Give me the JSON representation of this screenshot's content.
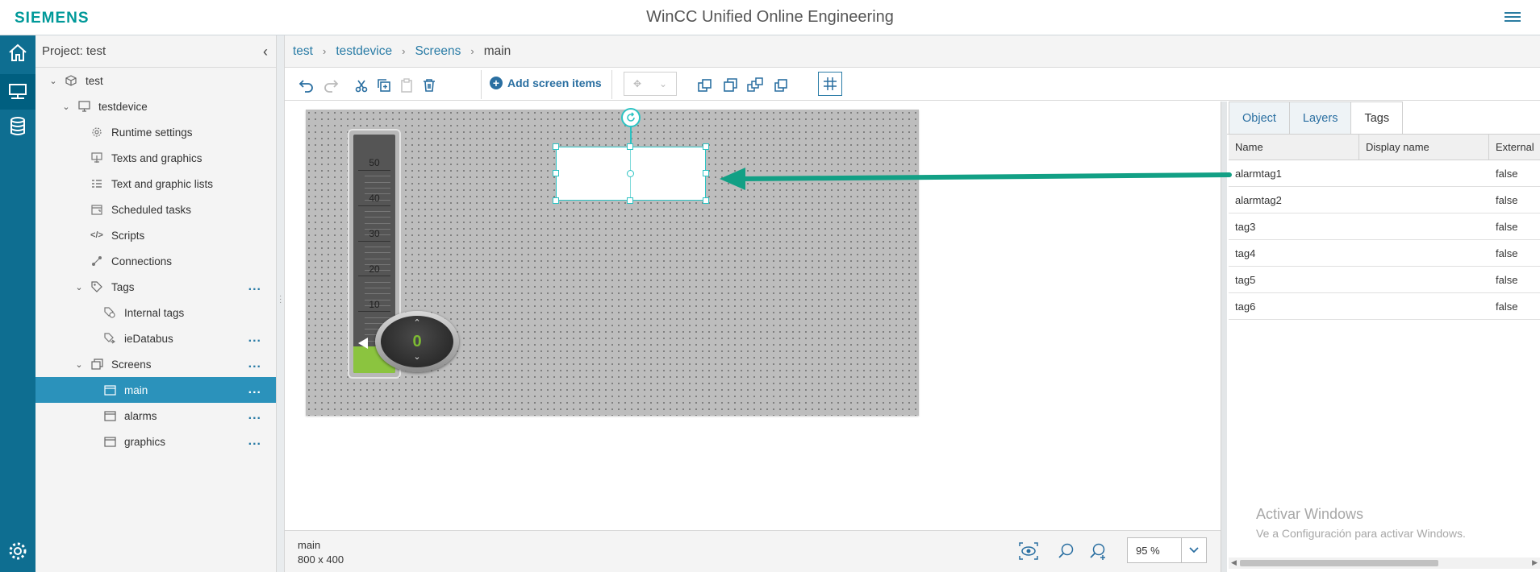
{
  "header": {
    "brand": "SIEMENS",
    "title": "WinCC Unified Online Engineering"
  },
  "rail": {
    "items": [
      "home-icon",
      "device-icon",
      "database-icon"
    ],
    "footer_icon": "settings-icon"
  },
  "tree": {
    "header": "Project: test",
    "nodes": {
      "test": "test",
      "testdevice": "testdevice",
      "runtime": "Runtime settings",
      "texts": "Texts and graphics",
      "lists": "Text and graphic lists",
      "scheduled": "Scheduled tasks",
      "scripts": "Scripts",
      "connections": "Connections",
      "tags": "Tags",
      "internal": "Internal tags",
      "databus": "ieDatabus",
      "screens": "Screens",
      "main": "main",
      "alarms": "alarms",
      "graphics": "graphics"
    },
    "more_label": "..."
  },
  "breadcrumb": {
    "items": [
      "test",
      "testdevice",
      "Screens"
    ],
    "current": "main",
    "separator": "›"
  },
  "toolbar": {
    "add_label": "Add screen items"
  },
  "canvas": {
    "gauge": {
      "labels": [
        "50",
        "40",
        "30",
        "20",
        "10"
      ],
      "fill_fraction": 0.11
    },
    "knob_value": "0"
  },
  "status": {
    "screen_name": "main",
    "screen_size": "800  x  400",
    "zoom": "95 %"
  },
  "panel": {
    "tabs": [
      "Object",
      "Layers",
      "Tags"
    ],
    "active_tab": "Tags",
    "columns": [
      "Name",
      "Display name",
      "External"
    ],
    "rows": [
      {
        "name": "alarmtag1",
        "display": "",
        "external": "false"
      },
      {
        "name": "alarmtag2",
        "display": "",
        "external": "false"
      },
      {
        "name": "tag3",
        "display": "",
        "external": "false"
      },
      {
        "name": "tag4",
        "display": "",
        "external": "false"
      },
      {
        "name": "tag5",
        "display": "",
        "external": "false"
      },
      {
        "name": "tag6",
        "display": "",
        "external": "false"
      }
    ],
    "watermark_title": "Activar Windows",
    "watermark_sub": "Ve a Configuración para activar Windows."
  },
  "colors": {
    "brand": "#009999",
    "rail": "#0e6e91",
    "selection": "#2b92bb",
    "accent_arrow": "#12a085",
    "gauge_fill": "#8bc43f"
  }
}
